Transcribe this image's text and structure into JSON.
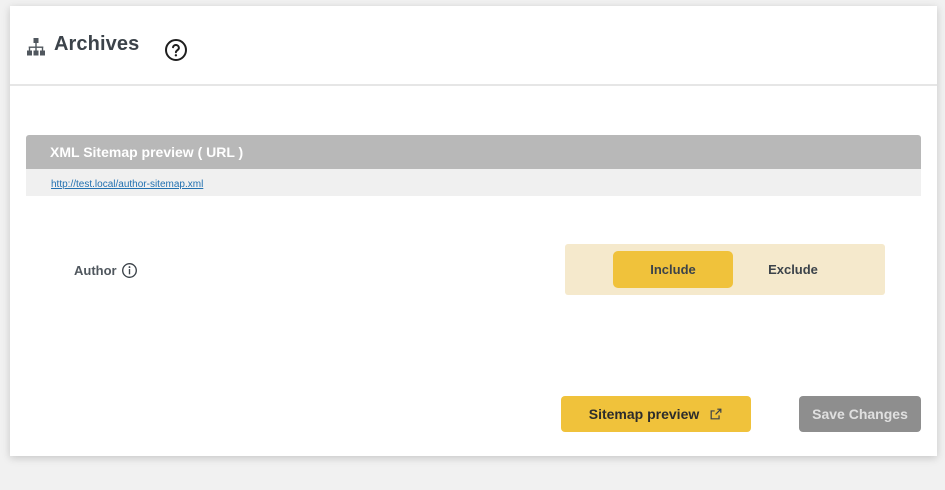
{
  "header": {
    "title": "Archives",
    "icons": {
      "section": "sitemap-icon",
      "help": "help-circle-icon"
    }
  },
  "preview": {
    "heading": "XML Sitemap preview ( URL )",
    "url": "http://test.local/author-sitemap.xml"
  },
  "setting": {
    "label": "Author",
    "info_icon": "info-icon",
    "options": [
      "Include",
      "Exclude"
    ],
    "selected": "Include"
  },
  "actions": {
    "preview_label": "Sitemap preview",
    "preview_icon": "external-link-icon",
    "save_label": "Save Changes"
  },
  "colors": {
    "accent": "#f0c23b",
    "toggle_bg": "#f5e9cc",
    "preview_head_bg": "#b8b8b8",
    "link": "#2271b1",
    "save_disabled_bg": "#8e8e8e"
  }
}
